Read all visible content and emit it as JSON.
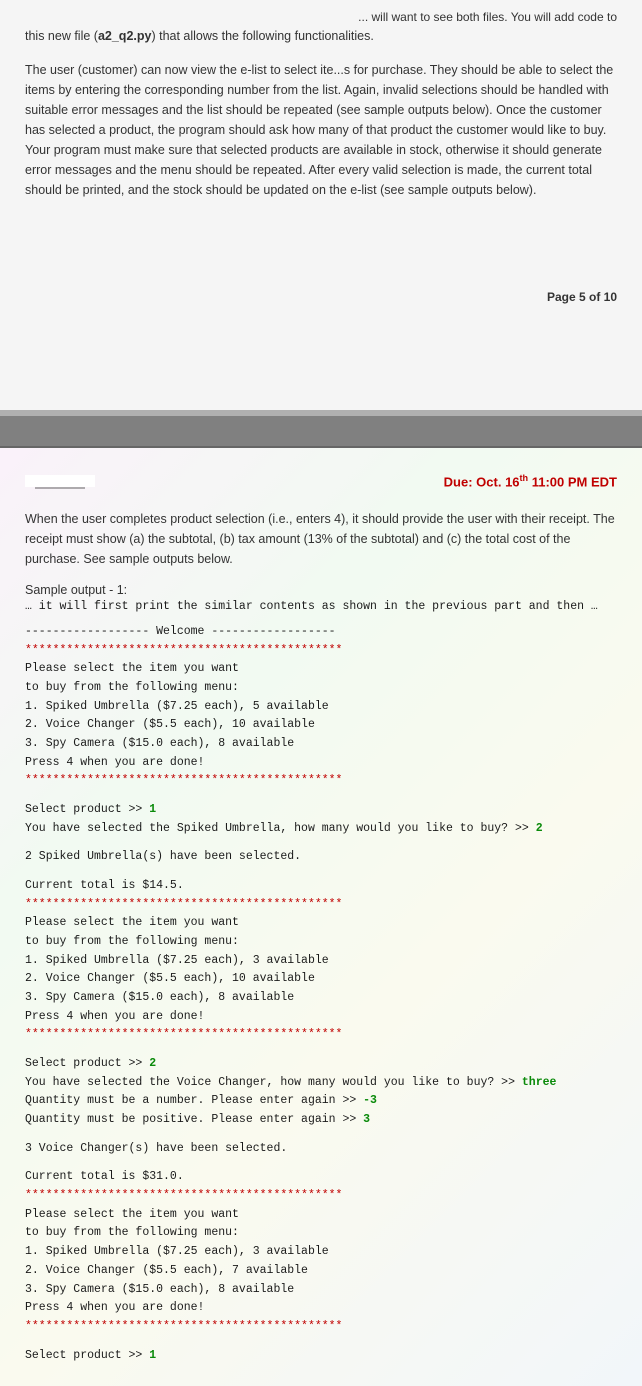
{
  "page_top": {
    "intro_fragment": "... will want to see both files. You will add code to",
    "intro_line": "this new file (a2_q2.py) that allows the following functionalities.",
    "filename": "a2_q2.py",
    "body": "The user (customer) can now view the e-list to select ite...s for purchase. They should be able to select the items by entering the corresponding number from the list. Again, invalid selections should be handled with suitable error messages and the list should be repeated (see sample outputs below). Once the customer has selected a product, the program should ask how many of that product the customer would like to buy. Your program must make sure that selected products are available in stock, otherwise it should generate error messages and the menu should be repeated. After every valid selection is made, the current total should be printed, and the stock should be updated on the e-list (see sample outputs below).",
    "page_num": "Page 5 of 10"
  },
  "page_bottom": {
    "due_date": "Due: Oct. 16th 11:00 PM EDT",
    "body": "When the user completes product selection (i.e., enters 4), it should provide the user with their receipt. The receipt must show (a) the subtotal, (b) tax amount (13% of the subtotal) and (c) the total cost of the purchase. See sample outputs below.",
    "sample_label": "Sample output - 1:",
    "sample_note": "… it will first print the similar contents as shown in the previous part and then …",
    "welcome_line": "------------------ Welcome ------------------",
    "sep": "**********************************************",
    "menu_intro1": "Please select the item you want",
    "menu_intro2": "to buy from the following menu:",
    "menu1_item1": "1. Spiked Umbrella ($7.25 each), 5 available",
    "menu1_item2": "2. Voice Changer ($5.5 each), 10 available",
    "menu1_item3": "3. Spy Camera ($15.0 each), 8 available",
    "menu_done": "Press 4 when you are done!",
    "select1_prompt": "Select product >> ",
    "select1_input": "1",
    "select1_resp": "You have selected the Spiked Umbrella, how many would you like to buy? >> ",
    "select1_qty": "2",
    "confirm1": "2 Spiked Umbrella(s) have been selected.",
    "total1": "Current total is $14.5.",
    "menu2_item1": "1. Spiked Umbrella ($7.25 each), 3 available",
    "menu2_item2": "2. Voice Changer ($5.5 each), 10 available",
    "menu2_item3": "3. Spy Camera ($15.0 each), 8 available",
    "select2_input": "2",
    "select2_resp": "You have selected the Voice Changer, how many would you like to buy? >> ",
    "select2_qty": "three",
    "err1": "Quantity must be a number. Please enter again >> ",
    "err1_input": "-3",
    "err2": "Quantity must be positive. Please enter again >> ",
    "err2_input": "3",
    "confirm2": "3 Voice Changer(s) have been selected.",
    "total2": "Current total is $31.0.",
    "menu3_item1": "1. Spiked Umbrella ($7.25 each), 3 available",
    "menu3_item2": "2. Voice Changer ($5.5 each), 7 available",
    "menu3_item3": "3. Spy Camera ($15.0 each), 8 available",
    "select3_prompt": "Select product >> ",
    "select3_input": "1"
  }
}
